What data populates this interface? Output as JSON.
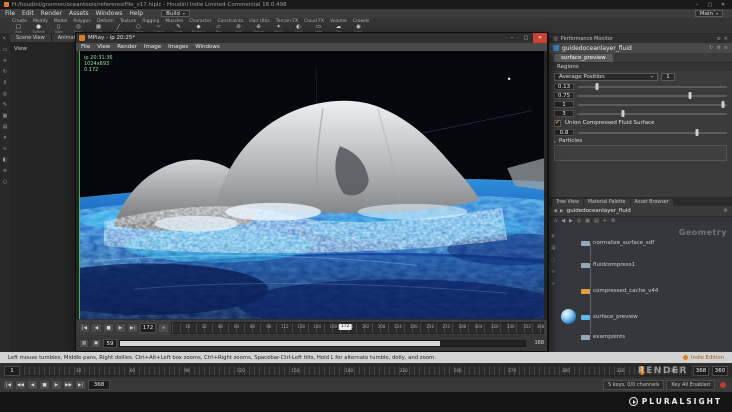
{
  "titlebar": {
    "title": "H:/houdini/gnomon/oceantools/referenceFile_v17.hiplc - Houdini Indie Limited-Commercial 18.0.498",
    "min": "–",
    "max": "▢",
    "close": "✕"
  },
  "menubar": {
    "items": [
      "File",
      "Edit",
      "Render",
      "Assets",
      "Windows",
      "Help"
    ],
    "desktop": "Build",
    "radial": "Main"
  },
  "shelf": {
    "tabs": [
      "Create",
      "Modify",
      "Model",
      "Polygon",
      "Deform",
      "Texture",
      "Rigging",
      "Muscles",
      "Character",
      "Constraints",
      "Hair Utils",
      "Terrain FX",
      "Cloud FX",
      "Volume",
      "Crowds"
    ],
    "tools": [
      {
        "g": "▢",
        "l": "Box"
      },
      {
        "g": "●",
        "l": "Sphere"
      },
      {
        "g": "▯",
        "l": "Tube"
      },
      {
        "g": "◎",
        "l": "Torus"
      },
      {
        "g": "▦",
        "l": "Grid"
      },
      {
        "g": "╱",
        "l": "Line"
      },
      {
        "g": "○",
        "l": "Circle"
      },
      {
        "g": "~",
        "l": "Curve"
      },
      {
        "g": "✎",
        "l": "Draw"
      },
      {
        "g": "◆",
        "l": "Platonic"
      },
      {
        "g": "▱",
        "l": "File"
      },
      {
        "g": "⊘",
        "l": "Null"
      },
      {
        "g": "⊕",
        "l": "Merge"
      },
      {
        "g": "✶",
        "l": "Point"
      },
      {
        "g": "◐",
        "l": "Spot"
      },
      {
        "g": "▭",
        "l": "Area"
      },
      {
        "g": "☁",
        "l": "Sky"
      },
      {
        "g": "◉",
        "l": "Cam"
      }
    ]
  },
  "lefttoolbar": {
    "icons": [
      "↖",
      "▭",
      "+",
      "↻",
      "⇕",
      "◎",
      "✎",
      "▦",
      "▤",
      "✶",
      "≈",
      "◧",
      "≡",
      "○"
    ]
  },
  "viewport": {
    "tabs": [
      "Scene View",
      "Animation Editor"
    ],
    "corner": "View"
  },
  "mplay": {
    "title": "MPlay - ip 20:25*",
    "min": "–",
    "max": "▢",
    "close": "✕",
    "menus": [
      "File",
      "View",
      "Render",
      "Image",
      "Images",
      "Windows"
    ],
    "overlay": [
      "ip 20:31:36",
      "1024x693",
      "0.172"
    ],
    "buttons": [
      "|◀",
      "◀",
      "■",
      "▶",
      "▶|"
    ],
    "frame": "172",
    "loop": "∞",
    "t1": "▥",
    "t2": "▣",
    "ruler": [
      {
        "t": "16",
        "p": "4.3%"
      },
      {
        "t": "32",
        "p": "8.7%"
      },
      {
        "t": "48",
        "p": "13%"
      },
      {
        "t": "64",
        "p": "17.4%"
      },
      {
        "t": "80",
        "p": "21.7%"
      },
      {
        "t": "96",
        "p": "26.1%"
      },
      {
        "t": "112",
        "p": "30.4%"
      },
      {
        "t": "128",
        "p": "34.8%"
      },
      {
        "t": "144",
        "p": "39.1%"
      },
      {
        "t": "160",
        "p": "43.5%"
      },
      {
        "t": "176",
        "p": "47.8%"
      },
      {
        "t": "192",
        "p": "52.2%"
      },
      {
        "t": "208",
        "p": "56.5%"
      },
      {
        "t": "224",
        "p": "60.9%"
      },
      {
        "t": "240",
        "p": "65.2%"
      },
      {
        "t": "256",
        "p": "69.6%"
      },
      {
        "t": "272",
        "p": "73.9%"
      },
      {
        "t": "288",
        "p": "78.3%"
      },
      {
        "t": "304",
        "p": "82.6%"
      },
      {
        "t": "320",
        "p": "87%"
      },
      {
        "t": "336",
        "p": "91.3%"
      },
      {
        "t": "352",
        "p": "95.7%"
      },
      {
        "t": "368",
        "p": "99.3%"
      }
    ],
    "playhead": {
      "label": "172",
      "p": "46.7%"
    },
    "mem": "59",
    "progress": "79%",
    "cache": "168"
  },
  "rightpanel": {
    "toptab": "Performance Monitor",
    "param": {
      "node": "guidedoceanlayer_fluid",
      "tools": [
        "↻",
        "⚙",
        "≡"
      ],
      "tab": "surface_preview",
      "section": "Regions",
      "dropdown": "Average Position",
      "spin": "1",
      "sliders": [
        {
          "v": "0.13",
          "p": "13%"
        },
        {
          "v": "0.75",
          "p": "75%"
        },
        {
          "v": "1",
          "p": "97%"
        },
        {
          "v": "3",
          "p": "30%"
        }
      ],
      "union": {
        "label": "Union Compressed Fluid Surface",
        "v": "0.8",
        "p": "80%"
      },
      "particles": "Particles"
    },
    "panetabs": [
      "Tree View",
      "Material Palette",
      "Asset Browser"
    ],
    "network": {
      "path": "guidedoceanlayer_fluid",
      "toolbar": [
        "⌂",
        "◀",
        "▶",
        "◎",
        "▦",
        "▤",
        "+",
        "⚙"
      ],
      "biglabel": "Geometry",
      "sidetools": [
        "◈",
        "▦",
        "○",
        "≡",
        "+"
      ],
      "nodes": [
        {
          "name": "normalize_surface_sdf",
          "c": "#93a7b8",
          "t": "14px"
        },
        {
          "name": "fluidcompress1",
          "c": "#93a7b8",
          "t": "36px"
        },
        {
          "name": "compressed_cache_v44",
          "c": "#dfa23f",
          "t": "62px"
        },
        {
          "name": "surface_preview",
          "c": "#5fb8e8",
          "t": "88px"
        },
        {
          "name": "exampoints",
          "c": "#93a7b8",
          "t": "108px"
        }
      ]
    }
  },
  "statusbar": {
    "help": "Left mouse tumbles, Middle pans, Right dollies. Ctrl+Alt+Left box zooms, Ctrl+Right zooms, Spacebar-Ctrl-Left tilts, Hold L for alternate tumble, dolly, and zoom.",
    "edition": "Indie Edition"
  },
  "timeline": {
    "start": "1",
    "labels": [
      {
        "t": "30",
        "p": "8.2%"
      },
      {
        "t": "60",
        "p": "16.3%"
      },
      {
        "t": "90",
        "p": "24.5%"
      },
      {
        "t": "120",
        "p": "32.6%"
      },
      {
        "t": "150",
        "p": "40.8%"
      },
      {
        "t": "180",
        "p": "48.9%"
      },
      {
        "t": "210",
        "p": "57.1%"
      },
      {
        "t": "240",
        "p": "65.2%"
      },
      {
        "t": "270",
        "p": "73.4%"
      },
      {
        "t": "300",
        "p": "81.5%"
      },
      {
        "t": "330",
        "p": "89.7%"
      },
      {
        "t": "360",
        "p": "97.8%"
      }
    ],
    "playhead": "93%",
    "end": "368",
    "range": "360"
  },
  "transport": {
    "buttons": [
      "|◀",
      "◀◀",
      "◀",
      "■",
      "▶",
      "▶▶",
      "▶|"
    ],
    "frame": "368",
    "keys": "5 keys, 0/0 channels",
    "keyall": "Key All Enabled"
  },
  "brand": {
    "watermark": "RENDER",
    "logo": "PLURALSIGHT"
  },
  "icons": {
    "check": "✔",
    "down": "▾",
    "right": "▸",
    "gear": "⚙",
    "left": "◀",
    "arrow": "▶",
    "menu": "≡",
    "close": "✕",
    "pane": "▥"
  }
}
